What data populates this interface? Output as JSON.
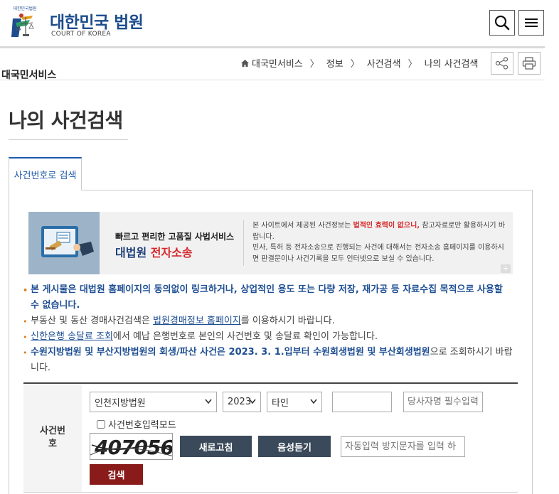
{
  "header": {
    "logo_emblem_text": "대한민국법원",
    "logo_title": "대한민국 법원",
    "logo_subtitle": "COURT OF KOREA",
    "icons": {
      "search": "search-icon",
      "menu": "hamburger-menu-icon"
    }
  },
  "subheader": {
    "section_title": "대국민서비스",
    "breadcrumb": [
      "대국민서비스",
      "정보",
      "사건검색",
      "나의 사건검색"
    ],
    "icons": {
      "home": "home-icon",
      "share": "share-icon",
      "print": "print-icon"
    }
  },
  "page_title": "나의 사건검색",
  "tabs": [
    {
      "label": "사건번호로 검색",
      "active": true
    }
  ],
  "banner": {
    "subtitle": "빠르고 편리한 고품질 사법서비스",
    "title_part1": "대법원 ",
    "title_part2": "전자소송",
    "text1_part1": "본 사이트에서 제공된 사건정보는 ",
    "text1_highlight": "법적인 효력이 없으니,",
    "text1_part2": " 참고자료로만 활용하시기 바랍니다.",
    "text2": "민사, 특허 등 전자소송으로 진행되는 사건에 대해서는 전자소송 홈페이지를 이용하시면 판결문이나 사건기록을 모두 인터넷으로 보실 수 있습니다.",
    "more": "+"
  },
  "notices": {
    "n1": "본 게시물은 대법원 홈페이지의 동의없이 링크하거나, 상업적인 용도 또는 다량 저장, 재가공 등 자료수집 목적으로 사용할 수 없습니다.",
    "n2_pre": "부동산 및 동산 경매사건검색은 ",
    "n2_link": "법원경매정보 홈페이지",
    "n2_post": "를 이용하시기 바랍니다.",
    "n3_link": "신한은행 송달료 조회",
    "n3_post": "에서 예납 은행번호로 본인의 사건번호 및 송달료 확인이 가능합니다.",
    "n4_bold": "수원지방법원 및 부산지방법원의 회생/파산 사건은 2023. 3. 1.입부터 수원회생법원 및 부산회생법원",
    "n4_post": "으로 조회하시기 바랍니다."
  },
  "form": {
    "label": "사건번호",
    "court_select": "인천지방법원",
    "year_select": "2023",
    "type_select": "타인",
    "case_number_value": "",
    "party_placeholder": "당사자명 필수입력",
    "checkbox_label": "사건번호입력모드",
    "captcha_text": "407056",
    "refresh_button": "새로고침",
    "audio_button": "음성듣기",
    "captcha_input_placeholder": "자동입력 방지문자를 입력 하",
    "search_button": "검색"
  },
  "colors": {
    "brand_blue": "#1d4d8c",
    "search_red": "#8a1b1b",
    "dark_button": "#3a4a5a",
    "highlight_red": "#d6282b"
  }
}
